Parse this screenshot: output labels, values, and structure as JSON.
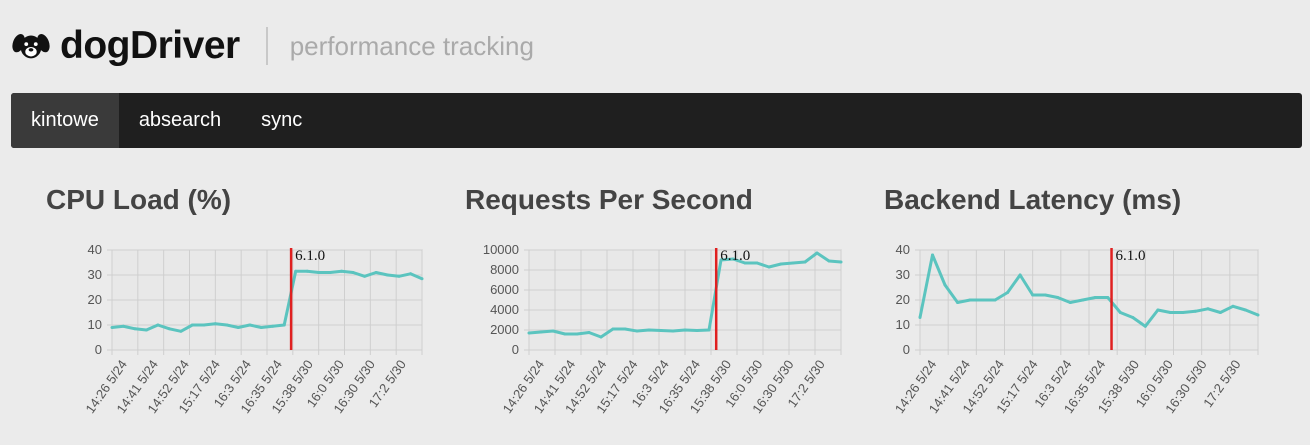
{
  "header": {
    "brand": "dogDriver",
    "tagline": "performance tracking",
    "logo_icon": "dog-face-icon"
  },
  "nav": {
    "items": [
      {
        "label": "kintowe",
        "active": true
      },
      {
        "label": "absearch",
        "active": false
      },
      {
        "label": "sync",
        "active": false
      }
    ]
  },
  "colors": {
    "line": "#5bc4bf",
    "release_marker": "#e02020",
    "navbar": "#1f1f1f"
  },
  "chart_data": [
    {
      "type": "line",
      "title": "CPU Load (%)",
      "categories": [
        "14:26 5/24",
        "14:41 5/24",
        "14:52 5/24",
        "15:17 5/24",
        "16:3 5/24",
        "16:35 5/24",
        "15:38 5/30",
        "16:0 5/30",
        "16:30 5/30",
        "17:2 5/30"
      ],
      "ylim": [
        0,
        40
      ],
      "yticks": [
        0,
        10,
        20,
        30,
        40
      ],
      "values": [
        9,
        9.5,
        8.5,
        8,
        10,
        8.5,
        7.5,
        10,
        10,
        10.5,
        10,
        9,
        10,
        9,
        9.5,
        10,
        31.5,
        31.5,
        31,
        31,
        31.5,
        31,
        29.5,
        31,
        30,
        29.5,
        30.5,
        28.5
      ],
      "release": {
        "label": "6.1.0",
        "index": 15.6
      }
    },
    {
      "type": "line",
      "title": "Requests Per Second",
      "categories": [
        "14:26 5/24",
        "14:41 5/24",
        "14:52 5/24",
        "15:17 5/24",
        "16:3 5/24",
        "16:35 5/24",
        "15:38 5/30",
        "16:0 5/30",
        "16:30 5/30",
        "17:2 5/30"
      ],
      "ylim": [
        0,
        10000
      ],
      "yticks": [
        0,
        2000,
        4000,
        6000,
        8000,
        10000
      ],
      "values": [
        1700,
        1800,
        1900,
        1600,
        1600,
        1750,
        1300,
        2100,
        2100,
        1900,
        2000,
        1950,
        1900,
        2000,
        1950,
        2000,
        9000,
        9100,
        8700,
        8700,
        8300,
        8600,
        8700,
        8800,
        9700,
        8900,
        8800
      ],
      "release": {
        "label": "6.1.0",
        "index": 15.6
      }
    },
    {
      "type": "line",
      "title": "Backend Latency (ms)",
      "categories": [
        "14:26 5/24",
        "14:41 5/24",
        "14:52 5/24",
        "15:17 5/24",
        "16:3 5/24",
        "16:35 5/24",
        "15:38 5/30",
        "16:0 5/30",
        "16:30 5/30",
        "17:2 5/30"
      ],
      "ylim": [
        0,
        40
      ],
      "yticks": [
        0,
        10,
        20,
        30,
        40
      ],
      "values": [
        13,
        38,
        26,
        19,
        20,
        20,
        20,
        23,
        30,
        22,
        22,
        21,
        19,
        20,
        21,
        21,
        15,
        13,
        9.5,
        16,
        15,
        15,
        15.5,
        16.5,
        15,
        17.5,
        16,
        14
      ],
      "release": {
        "label": "6.1.0",
        "index": 15.3
      }
    }
  ]
}
